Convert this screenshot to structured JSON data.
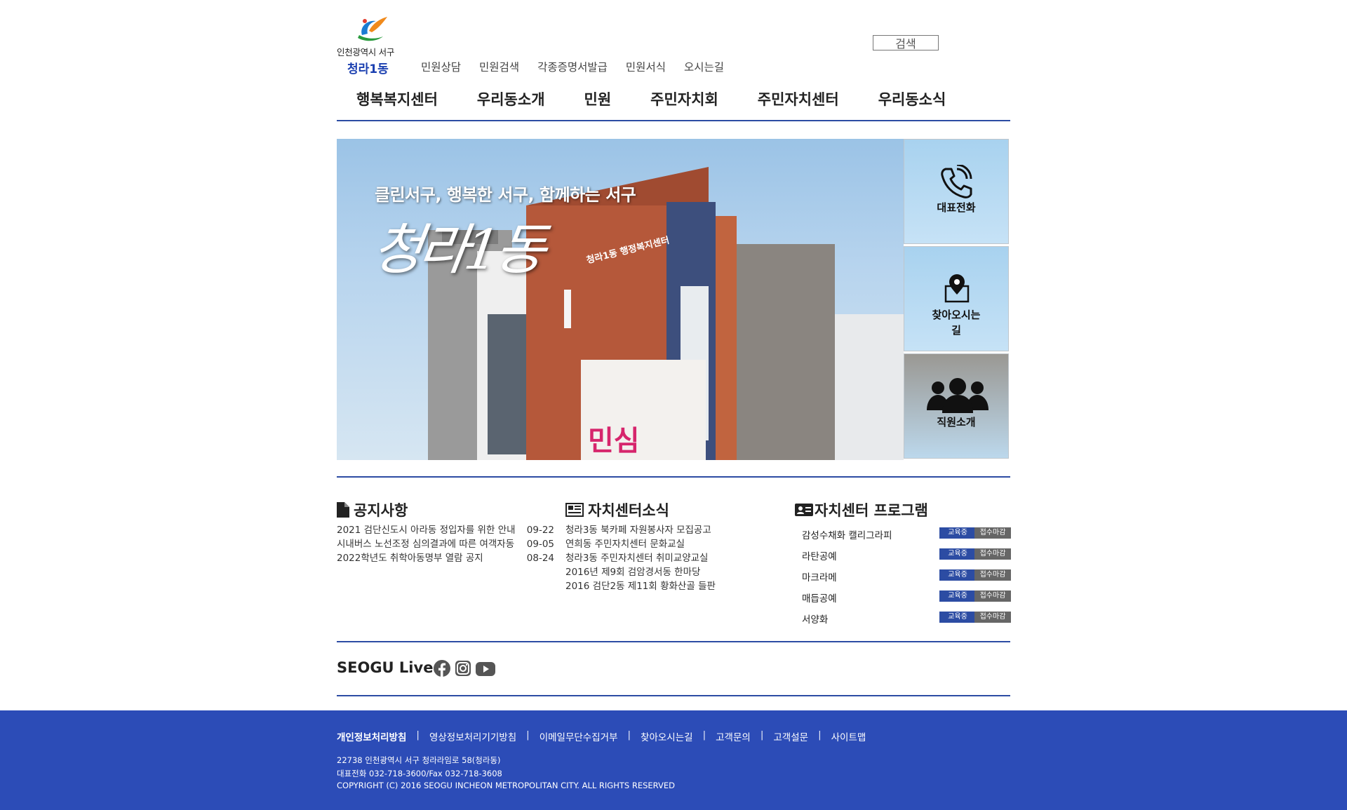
{
  "header": {
    "city": "인천광역시 서구",
    "dong": "청라1동",
    "util_nav": [
      "민원상담",
      "민원검색",
      "각종증명서발급",
      "민원서식",
      "오시는길"
    ],
    "search_label": "검색"
  },
  "gnb": [
    "행복복지센터",
    "우리동소개",
    "민원",
    "주민자치회",
    "주민자치센터",
    "우리동소식"
  ],
  "hero": {
    "slogan": "클린서구, 행복한 서구, 함께하는 서구",
    "script_title": "청라1동",
    "building_sign": "청라1동 행정복지센터",
    "banner_text": "민심"
  },
  "quick_links": [
    {
      "label": "대표전화",
      "icon": "phone-icon"
    },
    {
      "label": "찾아오시는\n길",
      "icon": "map-pin-icon"
    },
    {
      "label": "직원소개",
      "icon": "people-icon"
    }
  ],
  "notice": {
    "title": "공지사항",
    "items": [
      {
        "text": "2021 검단신도시 아라동 정입자를 위한 안내",
        "date": "09-22"
      },
      {
        "text": "시내버스 노선조정 심의결과에 따른 여객자동",
        "date": "09-05"
      },
      {
        "text": "2022학년도 취학아동명부 열람 공지",
        "date": "08-24"
      }
    ]
  },
  "news": {
    "title": "자치센터소식",
    "items": [
      "청라3동 북카페 자원봉사자 모집공고",
      "연희동 주민자치센터 문화교실",
      "청라3동 주민자치센터 취미교양교실",
      "2016년 제9회 검암경서동 한마당",
      "2016 검단2동 제11회 황화산골 들판"
    ]
  },
  "programs": {
    "title": "자치센터 프로그램",
    "status_a": "교육중",
    "status_b": "접수마감",
    "items": [
      "감성수채화 캘리그라피",
      "라탄공예",
      "마크라메",
      "매듭공예",
      "서양화"
    ]
  },
  "live": {
    "title": "SEOGU Live",
    "sns": [
      "facebook-icon",
      "instagram-icon",
      "youtube-icon"
    ]
  },
  "footer": {
    "links": [
      "개인정보처리방침",
      "영상정보처리기기방침",
      "이메일무단수집거부",
      "찾아오시는길",
      "고객문의",
      "고객설문",
      "사이트맵"
    ],
    "address": "22738 인천광역시 서구 청라라임로 58(청라동)",
    "phone": "대표전화 032-718-3600/Fax 032-718-3608",
    "copyright": "COPYRIGHT (C) 2016 SEOGU INCHEON METROPOLITAN CITY. ALL RIGHTS RESERVED"
  },
  "colors": {
    "accent": "#2c4ca3",
    "footer_bg": "#2c4cb7",
    "dong_text": "#1a3fb0"
  }
}
